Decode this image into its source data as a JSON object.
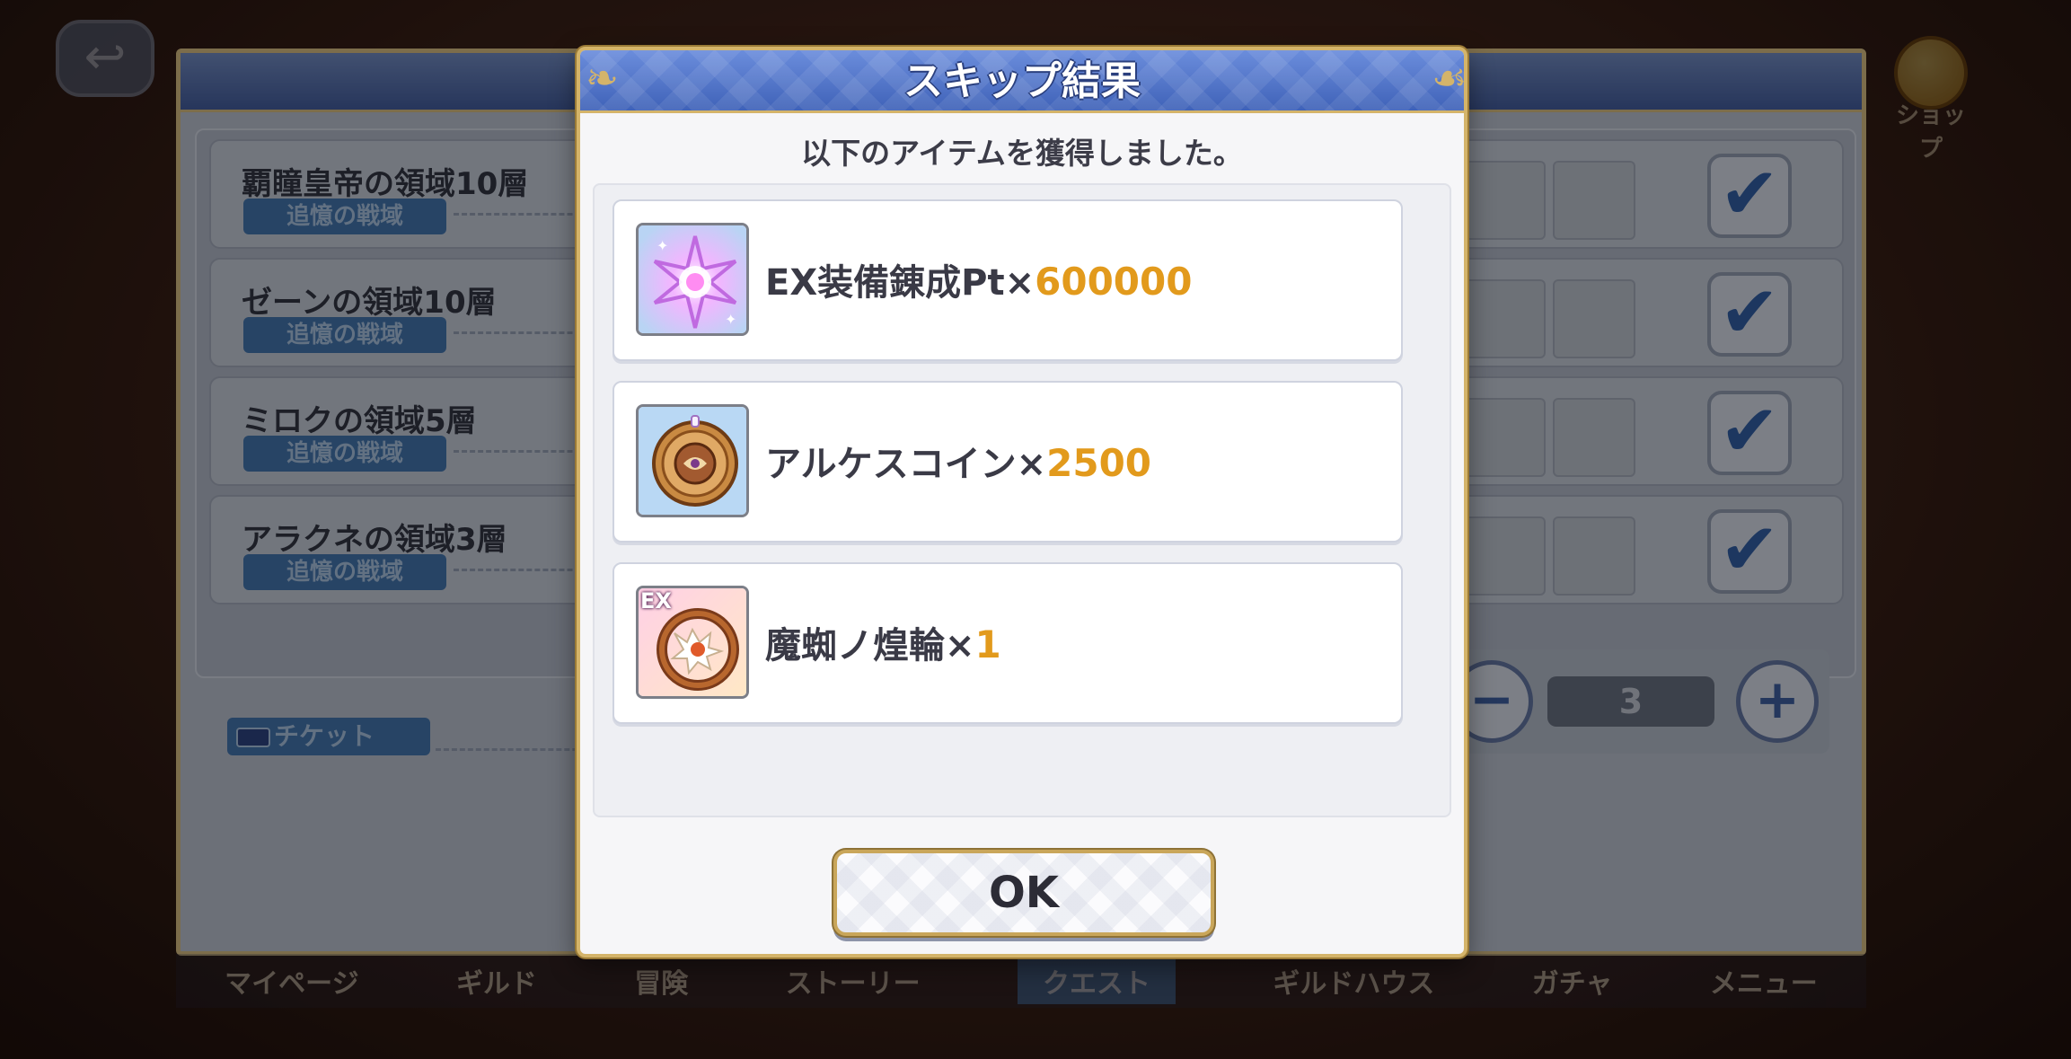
{
  "dialog": {
    "title": "スキップ結果",
    "subtitle": "以下のアイテムを獲得しました。",
    "items": [
      {
        "name": "EX装備錬成Pt×",
        "quantity": "600000",
        "icon": "ex-equip-pt-icon"
      },
      {
        "name": "アルケスコイン×",
        "quantity": "2500",
        "icon": "arkes-coin-icon"
      },
      {
        "name": "魔蜘ノ煌輪×",
        "quantity": "1",
        "icon": "ex-ring-icon",
        "badge": "EX"
      }
    ],
    "ok_label": "OK"
  },
  "background": {
    "quests": [
      {
        "title": "覇瞳皇帝の領域10層",
        "tag": "追憶の戦域"
      },
      {
        "title": "ゼーンの領域10層",
        "tag": "追憶の戦域"
      },
      {
        "title": "ミロクの領域5層",
        "tag": "追憶の戦域"
      },
      {
        "title": "アラクネの領域3層",
        "tag": "追憶の戦域"
      }
    ],
    "ticket_label": "チケット",
    "count_value": "3",
    "minus_label": "−",
    "plus_label": "+",
    "shop_label": "ショップ"
  },
  "nav": [
    "マイページ",
    "ギルド",
    "冒険",
    "ストーリー",
    "クエスト",
    "ギルドハウス",
    "ガチャ",
    "メニュー"
  ],
  "colors": {
    "header_blue": "#4a6cc0",
    "gold_border": "#d4b46a",
    "quantity_orange": "#e29a1c"
  }
}
